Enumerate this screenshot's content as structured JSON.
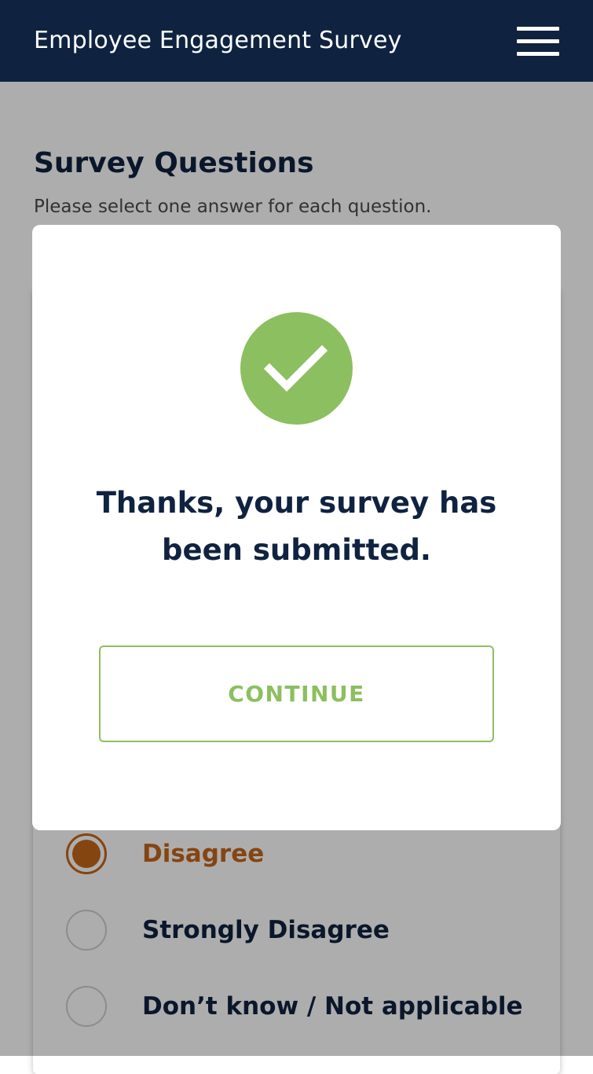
{
  "header": {
    "title": "Employee Engagement Survey",
    "menu_icon": "hamburger-menu-icon"
  },
  "main": {
    "section_title": "Survey Questions",
    "section_subtitle": "Please select one answer for each question.",
    "options": [
      {
        "label": "Disagree",
        "selected": true
      },
      {
        "label": "Strongly Disagree",
        "selected": false
      },
      {
        "label": "Don’t know / Not applicable",
        "selected": false
      }
    ]
  },
  "modal": {
    "icon": "checkmark-circle-icon",
    "message": "Thanks, your survey has been submitted.",
    "continue_label": "CONTINUE"
  },
  "colors": {
    "header_bg": "#0f2340",
    "accent_green": "#8cbf5f",
    "selected_orange": "#c4661a",
    "text_dark": "#0f2340"
  }
}
